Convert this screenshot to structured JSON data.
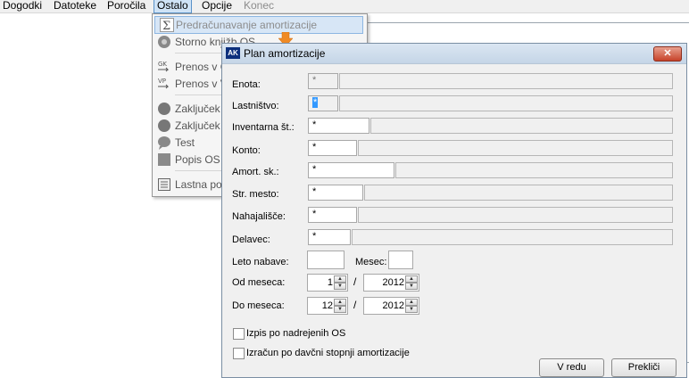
{
  "menubar": {
    "items": [
      {
        "label": "Dogodki"
      },
      {
        "label": "Datoteke"
      },
      {
        "label": "Poročila"
      },
      {
        "label": "Ostalo"
      },
      {
        "label": "Opcije"
      },
      {
        "label": "Konec"
      }
    ]
  },
  "dropdown": {
    "items": [
      {
        "label": "Predračunavanje amortizacije"
      },
      {
        "label": "Storno knjižb OS"
      },
      {
        "label": "Prenos v G"
      },
      {
        "label": "Prenos v V"
      },
      {
        "label": "Zaključek"
      },
      {
        "label": "Zaključek"
      },
      {
        "label": "Test"
      },
      {
        "label": "Popis OS s"
      },
      {
        "label": "Lastna por"
      }
    ]
  },
  "dialog": {
    "title": "Plan amortizacije",
    "close": "✕",
    "fields": {
      "enota": {
        "label": "Enota:",
        "value": "*"
      },
      "lastnistvo": {
        "label": "Lastništvo:",
        "value": "*"
      },
      "inventarna": {
        "label": "Inventarna št.:",
        "value": "*"
      },
      "konto": {
        "label": "Konto:",
        "value": "*"
      },
      "amort": {
        "label": "Amort. sk.:",
        "value": "*"
      },
      "strmesto": {
        "label": "Str. mesto:",
        "value": "*"
      },
      "nahajalisce": {
        "label": "Nahajališče:",
        "value": "*"
      },
      "delavec": {
        "label": "Delavec:",
        "value": "*"
      },
      "leto": {
        "label": "Leto nabave:",
        "value": ""
      },
      "mesec": {
        "label": "Mesec:",
        "value": ""
      }
    },
    "od_meseca": {
      "label": "Od meseca:",
      "month": "1",
      "year": "2012"
    },
    "do_meseca": {
      "label": "Do meseca:",
      "month": "12",
      "year": "2012"
    },
    "slash": "/",
    "checkbox1": "Izpis po nadrejenih OS",
    "checkbox2": "Izračun po davčni stopnji amortizacije",
    "ok": "V redu",
    "cancel": "Prekliči"
  },
  "colors": {
    "accent": "#0c2f7c",
    "arrow": "#f08a24",
    "close": "#c7432a"
  }
}
